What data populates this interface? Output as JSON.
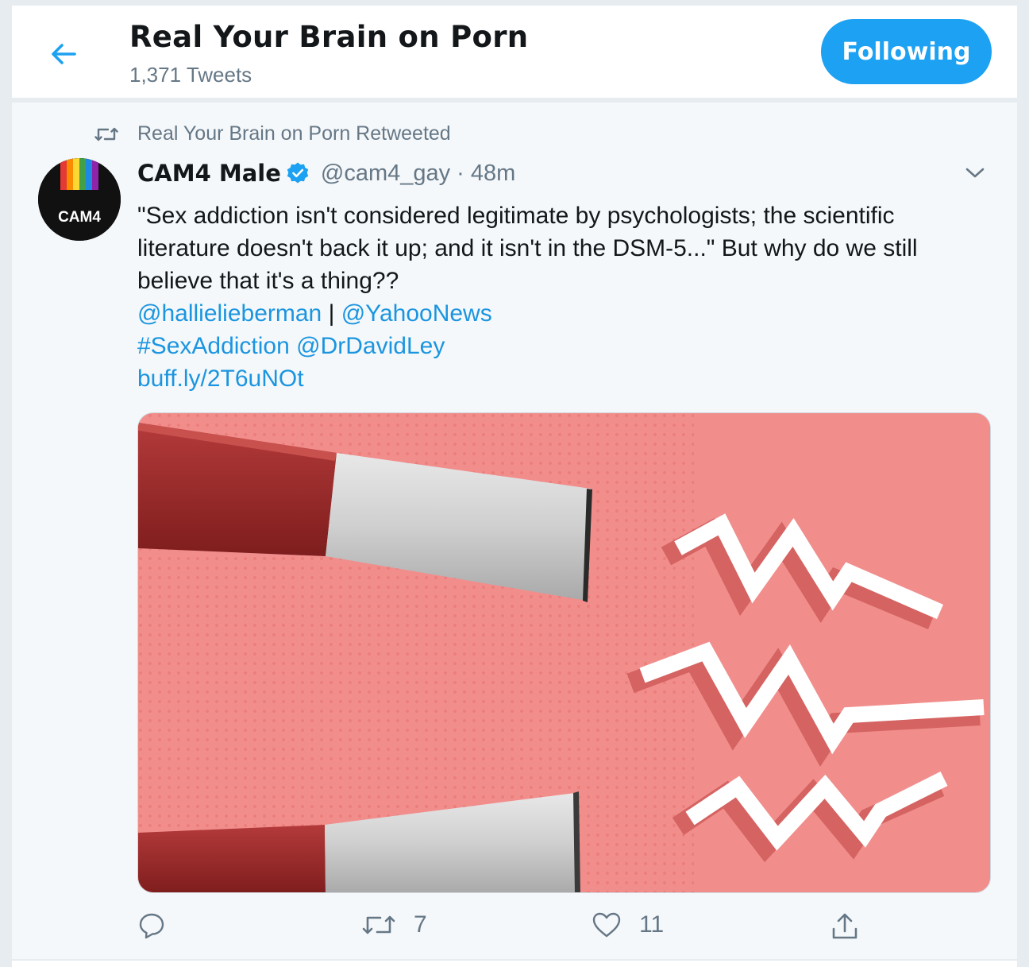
{
  "header": {
    "title": "Real Your Brain on Porn",
    "tweet_count": "1,371 Tweets",
    "follow_label": "Following"
  },
  "tweet": {
    "retweet_context": "Real Your Brain on Porn Retweeted",
    "author_name": "CAM4 Male",
    "handle": "@cam4_gay",
    "separator": "·",
    "time": "48m",
    "avatar_text": "CAM4",
    "text_lines": [
      "\"Sex addiction isn't considered legitimate by psychologists; the scientific",
      "literature doesn't back it up; and it isn't in the DSM-5...\" But why do we still",
      "believe that it's a thing??"
    ],
    "mention_1": "@hallielieberman",
    "pipe": " | ",
    "mention_2": "@YahooNews",
    "hashtag": "#SexAddiction",
    "mention_3": "@DrDavidLey",
    "url": "buff.ly/2T6uNOt",
    "actions": {
      "reply_icon": "reply-icon",
      "retweet_count": "7",
      "like_count": "11",
      "share_icon": "share-icon"
    }
  },
  "colors": {
    "accent": "#1da1f2",
    "link": "#1b95e0",
    "muted": "#657786",
    "media_bg": "#f08a88"
  }
}
